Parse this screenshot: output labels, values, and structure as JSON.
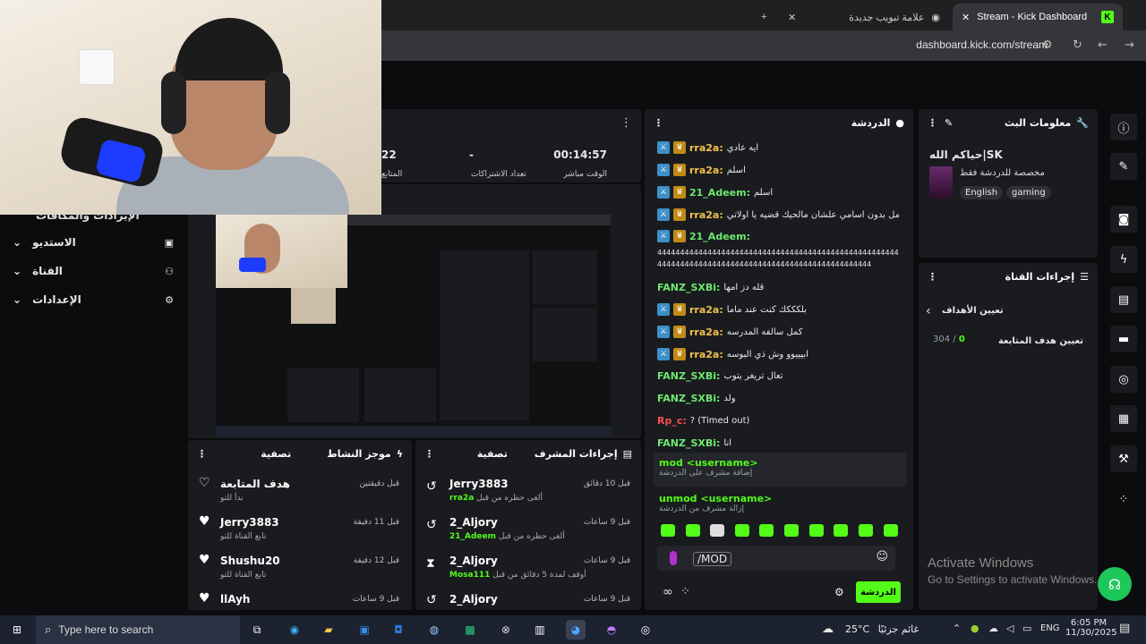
{
  "browser": {
    "tabs": [
      {
        "label": "Stream - Kick Dashboard",
        "close": "✕"
      },
      {
        "label": "علامة تبويب جديدة",
        "close": "✕"
      }
    ],
    "new_tab": "+",
    "url": "dashboard.kick.com/stream"
  },
  "kick_logo_letter": "K",
  "stats": {
    "timer": "00:14:57",
    "timer_label": "الوقت مباشر",
    "dash": "-",
    "dash_label": "تعداد الاشتراكات",
    "partial_number": "22",
    "partial_label": "المتابع"
  },
  "sidebar": {
    "items": [
      {
        "label": "الاستديو",
        "icon": "studio-icon"
      },
      {
        "label": "القناة",
        "icon": "users-icon"
      },
      {
        "label": "الإعدادات",
        "icon": "gear-icon"
      }
    ],
    "partial_top": "الإيرادات والمكافآت"
  },
  "chat": {
    "title": "الدردشة",
    "messages": [
      {
        "user": "rra2a:",
        "text": "ايه عادي",
        "color": "#f2c14e",
        "badges": true
      },
      {
        "user": "rra2a:",
        "text": "اسلم",
        "color": "#f2c14e",
        "badges": true
      },
      {
        "user": "21_Adeem:",
        "text": "اسلم",
        "color": "#6ee96e",
        "badges": true
      },
      {
        "user": "rra2a:",
        "text": "كمل بدون اسامي علشان مالحيك قضيه يا اولاتي",
        "color": "#f2c14e",
        "badges": true
      },
      {
        "user": "21_Adeem:",
        "text": "",
        "color": "#6ee96e",
        "badges": true
      }
    ],
    "long_line_1": "4444444444444444444444444444444444444444444444444444444444444444",
    "long_line_2": "44444444444444444444444444444444444444444444444",
    "messages2": [
      {
        "user": "FANZ_SXBi:",
        "text": "قله دز امها",
        "color": "#6ee96e",
        "badges": false
      },
      {
        "user": "rra2a:",
        "text": "بلكككك كنت عند ماما",
        "color": "#f2c14e",
        "badges": true
      },
      {
        "user": "rra2a:",
        "text": "كمل سالفه المدرسه",
        "color": "#f2c14e",
        "badges": true
      },
      {
        "user": "rra2a:",
        "text": "ابيييوو وش ذي البوسه",
        "color": "#f2c14e",
        "badges": true
      },
      {
        "user": "FANZ_SXBi:",
        "text": "تعال تريغر يتوب",
        "color": "#6ee96e",
        "badges": false
      },
      {
        "user": "FANZ_SXBi:",
        "text": "ولد",
        "color": "#6ee96e",
        "badges": false
      },
      {
        "user": "Rp_c:",
        "text": "? (Timed out)",
        "color": "#ff4d4d",
        "badges": false
      },
      {
        "user": "FANZ_SXBi:",
        "text": "انا",
        "color": "#6ee96e",
        "badges": false
      }
    ],
    "commands": [
      {
        "cmd": "mod <username>",
        "desc": "إضافة مشرف على الدردشة"
      },
      {
        "cmd": "unmod <username>",
        "desc": "إزالة مشرف من الدردشة"
      }
    ],
    "input_value": "/MOD",
    "send_label": "الدردشة"
  },
  "stream_info": {
    "title": "معلومات البث",
    "stream_title": "حياكم الله|SK",
    "category": "مخصصة للدردشة فقط",
    "tags": [
      "English",
      "gaming"
    ]
  },
  "channel_actions": {
    "title": "إجراءات القناة",
    "goals_title": "تعيين الأهداف",
    "goal_label": "تعيين هدف المتابعة",
    "goal_current": "0",
    "goal_sep": "/",
    "goal_target": "304"
  },
  "activity": {
    "title": "موجز النشاط",
    "filter": "تصفية",
    "rows": [
      {
        "name": "هدف المتابعة",
        "sub": "بدأ للتو",
        "time": "قبل دقيقتين",
        "icon": "heart-outline-icon"
      },
      {
        "name": "Jerry3883",
        "sub": "تابع القناة للتو",
        "time": "قبل 11 دقيقة",
        "icon": "heart-icon"
      },
      {
        "name": "Shushu20",
        "sub": "تابع القناة للتو",
        "time": "قبل 12 دقيقة",
        "icon": "heart-icon"
      },
      {
        "name": "llAyh",
        "sub": "",
        "time": "قبل 9 ساعات",
        "icon": "heart-icon"
      }
    ]
  },
  "mod_actions": {
    "title": "إجراءات المشرف",
    "filter": "تصفية",
    "rows": [
      {
        "name": "Jerry3883",
        "sub": "ألغى حظره من قبل",
        "by": "rra2a",
        "time": "قبل 10 دقائق",
        "icon": "undo-icon"
      },
      {
        "name": "2_Aljory",
        "sub": "ألغى حظره من قبل",
        "by": "21_Adeem",
        "time": "قبل 9 ساعات",
        "icon": "undo-icon"
      },
      {
        "name": "2_Aljory",
        "sub": "أوقف لمدة 5 دقائق من قبل",
        "by": "Mosa111",
        "time": "قبل 9 ساعات",
        "icon": "hourglass-icon"
      },
      {
        "name": "2_Aljory",
        "sub": "",
        "by": "",
        "time": "قبل 9 ساعات",
        "icon": "undo-icon"
      }
    ]
  },
  "watermark": {
    "line1": "Activate Windows",
    "line2": "Go to Settings to activate Windows."
  },
  "taskbar": {
    "search_placeholder": "Type here to search",
    "weather_temp": "25°C",
    "weather_text": "غائم جزئيًا",
    "lang": "ENG",
    "time": "6:05 PM",
    "date": "11/30/2025"
  }
}
